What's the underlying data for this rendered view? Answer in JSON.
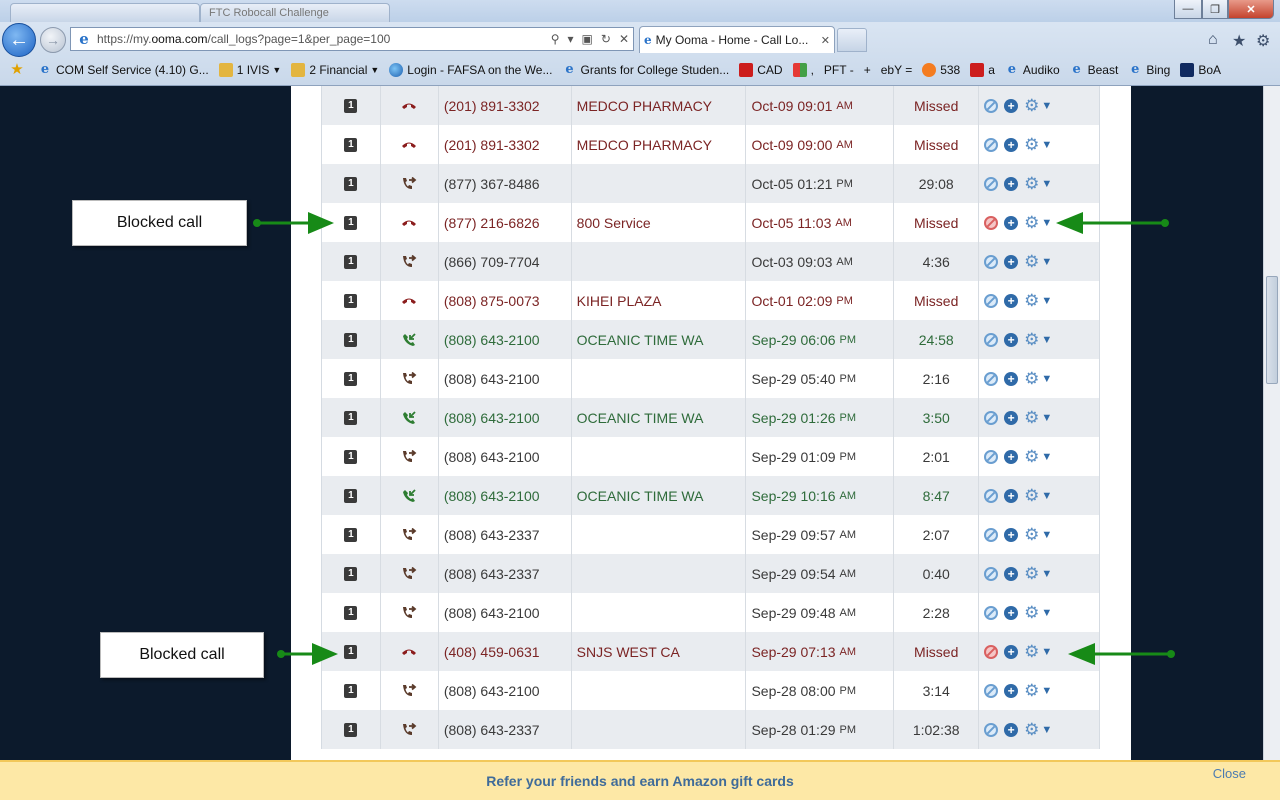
{
  "browser": {
    "url_prefix": "https://my.",
    "url_domain": "ooma.com",
    "url_rest": "/call_logs?page=1&per_page=100",
    "active_tab_title": "My Ooma - Home - Call Lo...",
    "background_tabs": [
      "",
      "FTC Robocall Challenge"
    ]
  },
  "favorites": [
    {
      "label": "",
      "icon": "star"
    },
    {
      "label": "COM Self Service (4.10) G...",
      "icon": "ie"
    },
    {
      "label": "1 IVIS",
      "icon": "folder",
      "dropdown": true
    },
    {
      "label": "2 Financial",
      "icon": "folder",
      "dropdown": true
    },
    {
      "label": "Login - FAFSA on the We...",
      "icon": "globe"
    },
    {
      "label": "Grants for College Studen...",
      "icon": "ie"
    },
    {
      "label": "CAD",
      "icon": "red"
    },
    {
      "label": ",",
      "icon": "multi"
    },
    {
      "label": "PFT -",
      "icon": "none"
    },
    {
      "label": "+",
      "icon": "none"
    },
    {
      "label": "ebY =",
      "icon": "none"
    },
    {
      "label": "538",
      "icon": "orange"
    },
    {
      "label": "a",
      "icon": "red"
    },
    {
      "label": "Audiko",
      "icon": "ie"
    },
    {
      "label": "Beast",
      "icon": "ie"
    },
    {
      "label": "Bing",
      "icon": "ie"
    },
    {
      "label": "BoA",
      "icon": "navy"
    }
  ],
  "call_log": [
    {
      "line": "1",
      "type": "missed",
      "number": "(201) 891-3302",
      "name": "MEDCO PHARMACY",
      "date": "Oct-09 09:01",
      "ampm": "AM",
      "duration": "Missed",
      "blocked": false
    },
    {
      "line": "1",
      "type": "missed",
      "number": "(201) 891-3302",
      "name": "MEDCO PHARMACY",
      "date": "Oct-09 09:00",
      "ampm": "AM",
      "duration": "Missed",
      "blocked": false
    },
    {
      "line": "1",
      "type": "out",
      "number": "(877) 367-8486",
      "name": "",
      "date": "Oct-05 01:21",
      "ampm": "PM",
      "duration": "29:08",
      "blocked": false
    },
    {
      "line": "1",
      "type": "missed",
      "number": "(877) 216-6826",
      "name": "800 Service",
      "date": "Oct-05 11:03",
      "ampm": "AM",
      "duration": "Missed",
      "blocked": true
    },
    {
      "line": "1",
      "type": "out",
      "number": "(866) 709-7704",
      "name": "",
      "date": "Oct-03 09:03",
      "ampm": "AM",
      "duration": "4:36",
      "blocked": false
    },
    {
      "line": "1",
      "type": "missed",
      "number": "(808) 875-0073",
      "name": "KIHEI PLAZA",
      "date": "Oct-01 02:09",
      "ampm": "PM",
      "duration": "Missed",
      "blocked": false
    },
    {
      "line": "1",
      "type": "in",
      "number": "(808) 643-2100",
      "name": "OCEANIC TIME WA",
      "date": "Sep-29 06:06",
      "ampm": "PM",
      "duration": "24:58",
      "blocked": false
    },
    {
      "line": "1",
      "type": "out",
      "number": "(808) 643-2100",
      "name": "",
      "date": "Sep-29 05:40",
      "ampm": "PM",
      "duration": "2:16",
      "blocked": false
    },
    {
      "line": "1",
      "type": "in",
      "number": "(808) 643-2100",
      "name": "OCEANIC TIME WA",
      "date": "Sep-29 01:26",
      "ampm": "PM",
      "duration": "3:50",
      "blocked": false
    },
    {
      "line": "1",
      "type": "out",
      "number": "(808) 643-2100",
      "name": "",
      "date": "Sep-29 01:09",
      "ampm": "PM",
      "duration": "2:01",
      "blocked": false
    },
    {
      "line": "1",
      "type": "in",
      "number": "(808) 643-2100",
      "name": "OCEANIC TIME WA",
      "date": "Sep-29 10:16",
      "ampm": "AM",
      "duration": "8:47",
      "blocked": false
    },
    {
      "line": "1",
      "type": "out",
      "number": "(808) 643-2337",
      "name": "",
      "date": "Sep-29 09:57",
      "ampm": "AM",
      "duration": "2:07",
      "blocked": false
    },
    {
      "line": "1",
      "type": "out",
      "number": "(808) 643-2337",
      "name": "",
      "date": "Sep-29 09:54",
      "ampm": "AM",
      "duration": "0:40",
      "blocked": false
    },
    {
      "line": "1",
      "type": "out",
      "number": "(808) 643-2100",
      "name": "",
      "date": "Sep-29 09:48",
      "ampm": "AM",
      "duration": "2:28",
      "blocked": false
    },
    {
      "line": "1",
      "type": "missed",
      "number": "(408) 459-0631",
      "name": "SNJS WEST CA",
      "date": "Sep-29 07:13",
      "ampm": "AM",
      "duration": "Missed",
      "blocked": true
    },
    {
      "line": "1",
      "type": "out",
      "number": "(808) 643-2100",
      "name": "",
      "date": "Sep-28 08:00",
      "ampm": "PM",
      "duration": "3:14",
      "blocked": false
    },
    {
      "line": "1",
      "type": "out",
      "number": "(808) 643-2337",
      "name": "",
      "date": "Sep-28 01:29",
      "ampm": "PM",
      "duration": "1:02:38",
      "blocked": false
    }
  ],
  "annotations": {
    "callout_1": "Blocked call",
    "callout_2": "Blocked call",
    "arrow_color": "#178a17"
  },
  "banner": {
    "text": "Refer your friends and earn Amazon gift cards",
    "close_label": "Close"
  },
  "colors": {
    "missed": "#7b2424",
    "incoming": "#2e6b3a",
    "outgoing": "#3a3a3a",
    "page_background": "#0c1a2c"
  }
}
